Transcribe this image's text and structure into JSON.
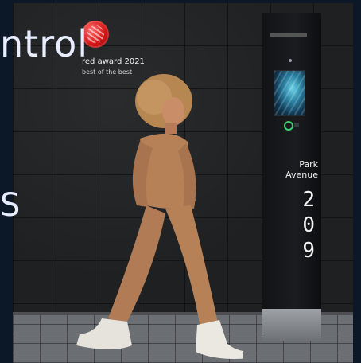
{
  "headline": {
    "text": "ntrol",
    "side_glyph": "S"
  },
  "award": {
    "line1": "red   award 2021",
    "line2": "best of the best",
    "logo": "red-dot-logo"
  },
  "kiosk": {
    "label_line1": "Park",
    "label_line2": "Avenue",
    "digits": [
      "2",
      "0",
      "9"
    ]
  },
  "colors": {
    "background": "#0c1728",
    "headline": "#e8eeff",
    "award_red": "#d41616",
    "kiosk_ring": "#37d46b"
  }
}
